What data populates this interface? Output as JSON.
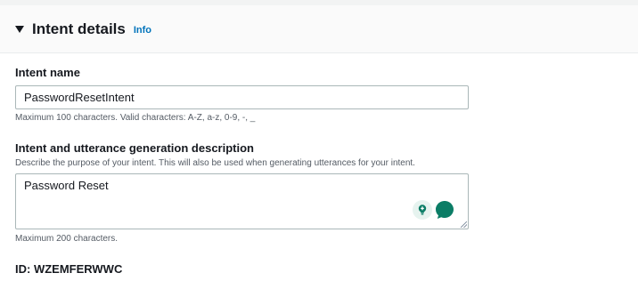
{
  "section": {
    "title": "Intent details",
    "info_label": "Info"
  },
  "intent_name": {
    "label": "Intent name",
    "value": "PasswordResetIntent",
    "hint": "Maximum 100 characters. Valid characters: A-Z, a-z, 0-9, -, _"
  },
  "description": {
    "label": "Intent and utterance generation description",
    "sublabel": "Describe the purpose of your intent. This will also be used when generating utterances for your intent.",
    "value": "Password Reset",
    "hint": "Maximum 200 characters."
  },
  "assist_icons": [
    "lightbulb-icon",
    "chat-bubble-icon"
  ],
  "colors": {
    "accent_link": "#0073bb",
    "assist_green": "#0b7d66"
  },
  "intent_id": {
    "text": "ID: WZEMFERWWC"
  }
}
